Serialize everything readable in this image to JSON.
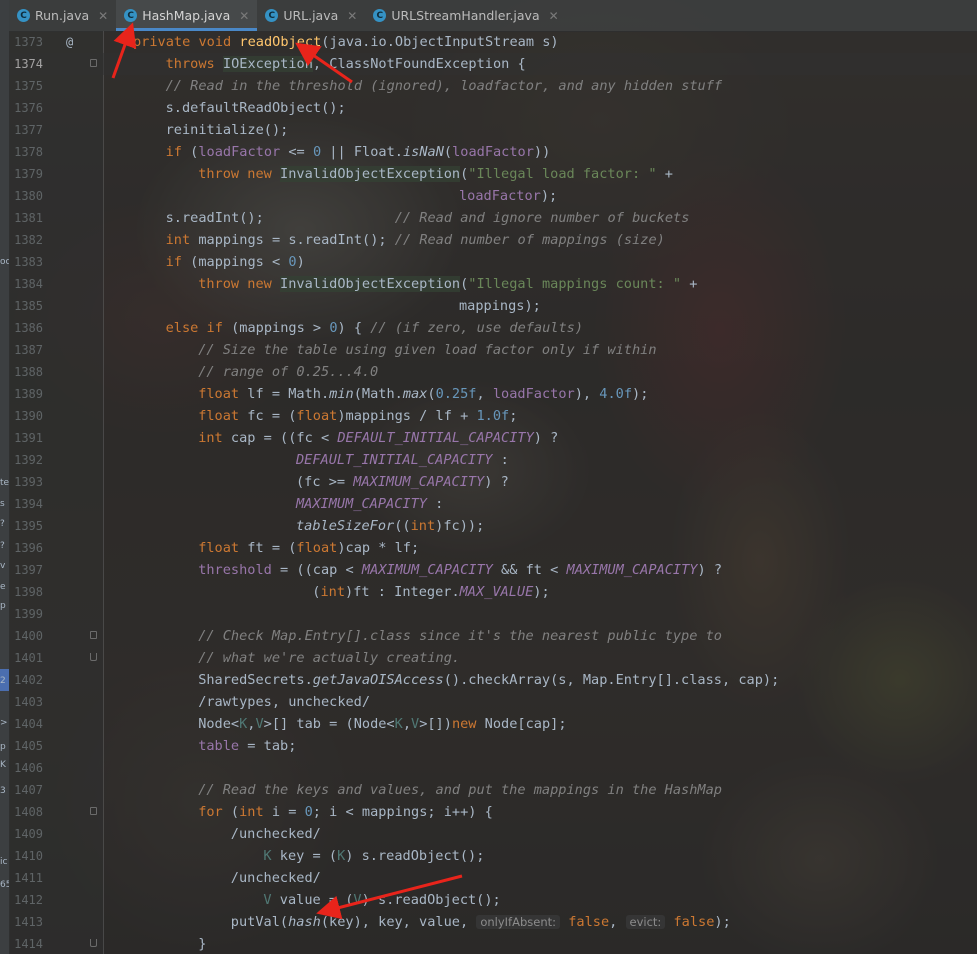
{
  "tabs": [
    {
      "label": "Run.java",
      "active": false
    },
    {
      "label": "HashMap.java",
      "active": true
    },
    {
      "label": "URL.java",
      "active": false
    },
    {
      "label": "URLStreamHandler.java",
      "active": false
    }
  ],
  "left_strip_fragments": [
    "oc",
    "te",
    "s",
    "?",
    "?",
    "v",
    "e",
    "p",
    "2",
    ">",
    "p",
    "K",
    "3",
    "ic",
    "65"
  ],
  "editor": {
    "current_line": 1374,
    "annotation_glyph": "@",
    "lines": [
      {
        "n": 1373,
        "text": "private void readObject(java.io.ObjectInputStream s)"
      },
      {
        "n": 1374,
        "text": "throws IOException, ClassNotFoundException {"
      },
      {
        "n": 1375,
        "text": "// Read in the threshold (ignored), loadfactor, and any hidden stuff"
      },
      {
        "n": 1376,
        "text": "s.defaultReadObject();"
      },
      {
        "n": 1377,
        "text": "reinitialize();"
      },
      {
        "n": 1378,
        "text": "if (loadFactor <= 0 || Float.isNaN(loadFactor))"
      },
      {
        "n": 1379,
        "text": "throw new InvalidObjectException(\"Illegal load factor: \" +"
      },
      {
        "n": 1380,
        "text": "loadFactor);"
      },
      {
        "n": 1381,
        "text": "s.readInt();                // Read and ignore number of buckets"
      },
      {
        "n": 1382,
        "text": "int mappings = s.readInt(); // Read number of mappings (size)"
      },
      {
        "n": 1383,
        "text": "if (mappings < 0)"
      },
      {
        "n": 1384,
        "text": "throw new InvalidObjectException(\"Illegal mappings count: \" +"
      },
      {
        "n": 1385,
        "text": "mappings);"
      },
      {
        "n": 1386,
        "text": "else if (mappings > 0) { // (if zero, use defaults)"
      },
      {
        "n": 1387,
        "text": "// Size the table using given load factor only if within"
      },
      {
        "n": 1388,
        "text": "// range of 0.25...4.0"
      },
      {
        "n": 1389,
        "text": "float lf = Math.min(Math.max(0.25f, loadFactor), 4.0f);"
      },
      {
        "n": 1390,
        "text": "float fc = (float)mappings / lf + 1.0f;"
      },
      {
        "n": 1391,
        "text": "int cap = ((fc < DEFAULT_INITIAL_CAPACITY) ?"
      },
      {
        "n": 1392,
        "text": "DEFAULT_INITIAL_CAPACITY :"
      },
      {
        "n": 1393,
        "text": "(fc >= MAXIMUM_CAPACITY) ?"
      },
      {
        "n": 1394,
        "text": "MAXIMUM_CAPACITY :"
      },
      {
        "n": 1395,
        "text": "tableSizeFor((int)fc));"
      },
      {
        "n": 1396,
        "text": "float ft = (float)cap * lf;"
      },
      {
        "n": 1397,
        "text": "threshold = ((cap < MAXIMUM_CAPACITY && ft < MAXIMUM_CAPACITY) ?"
      },
      {
        "n": 1398,
        "text": "(int)ft : Integer.MAX_VALUE);"
      },
      {
        "n": 1399,
        "text": ""
      },
      {
        "n": 1400,
        "text": "// Check Map.Entry[].class since it's the nearest public type to"
      },
      {
        "n": 1401,
        "text": "// what we're actually creating."
      },
      {
        "n": 1402,
        "text": "SharedSecrets.getJavaOISAccess().checkArray(s, Map.Entry[].class, cap);"
      },
      {
        "n": 1403,
        "text": "/rawtypes, unchecked/"
      },
      {
        "n": 1404,
        "text": "Node<K,V>[] tab = (Node<K,V>[])new Node[cap];"
      },
      {
        "n": 1405,
        "text": "table = tab;"
      },
      {
        "n": 1406,
        "text": ""
      },
      {
        "n": 1407,
        "text": "// Read the keys and values, and put the mappings in the HashMap"
      },
      {
        "n": 1408,
        "text": "for (int i = 0; i < mappings; i++) {"
      },
      {
        "n": 1409,
        "text": "/unchecked/"
      },
      {
        "n": 1410,
        "text": "K key = (K) s.readObject();"
      },
      {
        "n": 1411,
        "text": "/unchecked/"
      },
      {
        "n": 1412,
        "text": "V value = (V) s.readObject();"
      },
      {
        "n": 1413,
        "text": "putVal(hash(key), key, value, onlyIfAbsent: false, evict: false);"
      },
      {
        "n": 1414,
        "text": "}"
      }
    ],
    "hints": {
      "only_if_absent": "onlyIfAbsent:",
      "evict": "evict:"
    }
  },
  "colors": {
    "keyword": "#cc7832",
    "method_decl": "#ffc66d",
    "string": "#6a8759",
    "number": "#6897bb",
    "comment": "#808080",
    "constant": "#9876aa",
    "annotation_arrow": "#e8241b",
    "tab_underline": "#4a88c7"
  }
}
